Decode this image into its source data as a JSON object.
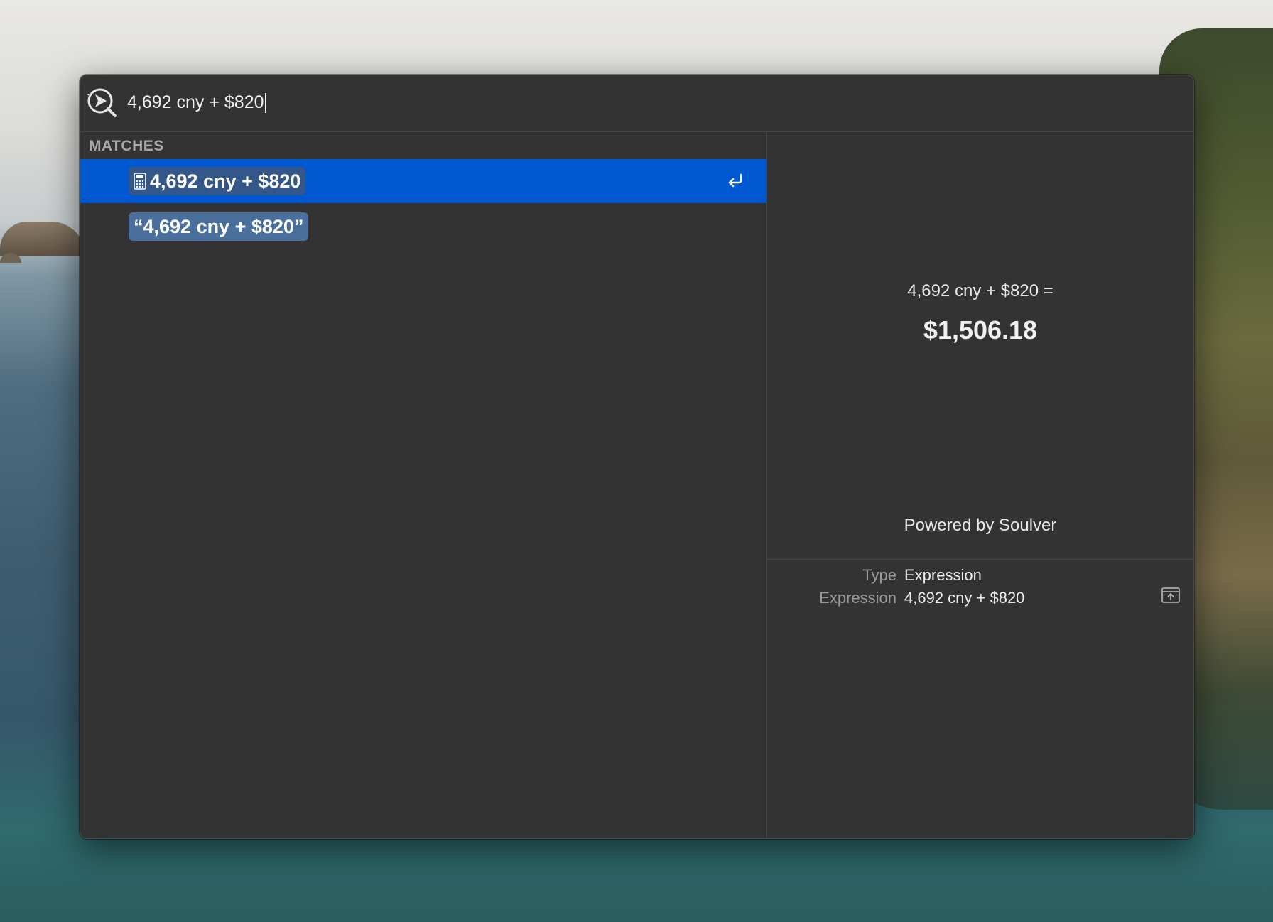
{
  "search": {
    "query": "4,692 cny + $820"
  },
  "results": {
    "section_label": "MATCHES",
    "items": [
      {
        "label": "4,692 cny + $820",
        "icon": "calculator-icon",
        "selected": true,
        "action_icon": "return-key-icon"
      },
      {
        "label": "“4,692 cny + $820”",
        "icon": "",
        "selected": false
      }
    ]
  },
  "preview": {
    "expression": "4,692 cny + $820 =",
    "result": "$1,506.18",
    "powered_by": "Powered by Soulver"
  },
  "metadata": {
    "rows": [
      {
        "key": "Type",
        "value": "Expression"
      },
      {
        "key": "Expression",
        "value": "4,692 cny + $820"
      }
    ],
    "action_icon": "share-icon"
  },
  "colors": {
    "window_bg": "#333333",
    "selection": "#0058d0",
    "pill": "#4a6f9c"
  }
}
